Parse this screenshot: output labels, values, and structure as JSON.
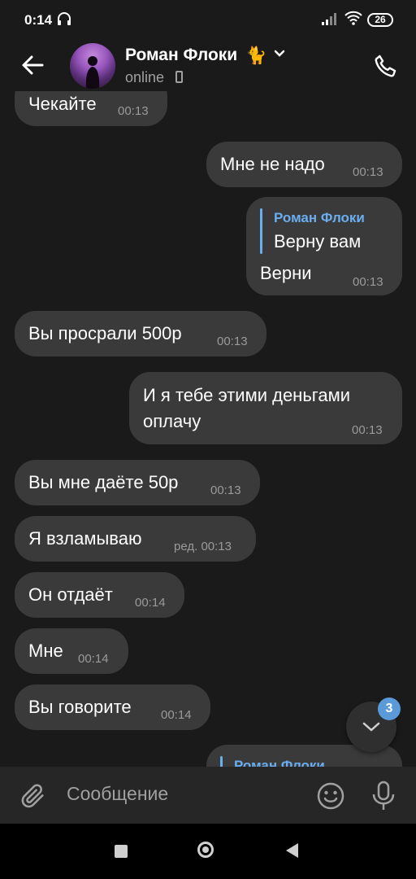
{
  "status_bar": {
    "time": "0:14",
    "battery": "26"
  },
  "header": {
    "contact_name": "Роман Флоки",
    "name_emoji": "🐈",
    "status": "online"
  },
  "messages": [
    {
      "side": "in",
      "text": "Чекайте",
      "time": "00:13"
    },
    {
      "side": "out",
      "text": "Мне не надо",
      "time": "00:13"
    },
    {
      "side": "out",
      "reply_name": "Роман Флоки",
      "reply_text": "Верну вам",
      "text": "Верни",
      "time": "00:13"
    },
    {
      "side": "in",
      "text": "Вы просрали 500р",
      "time": "00:13"
    },
    {
      "side": "out",
      "text_line1": "И я тебе этими деньгами",
      "text_line2": "оплачу",
      "time": "00:13"
    },
    {
      "side": "in",
      "text": "Вы мне даёте 50р",
      "time": "00:13"
    },
    {
      "side": "in",
      "text": "Я взламываю",
      "time": "ред. 00:13"
    },
    {
      "side": "in",
      "text": "Он отдаёт",
      "time": "00:14"
    },
    {
      "side": "in",
      "text": "Мне",
      "time": "00:14"
    },
    {
      "side": "in",
      "text": "Вы говорите",
      "time": "00:14"
    },
    {
      "side": "out",
      "reply_name": "Роман Флоки"
    }
  ],
  "scroll_down": {
    "unread_count": "3"
  },
  "composer": {
    "placeholder": "Сообщение"
  },
  "colors": {
    "background": "#1a1a1a",
    "bubble": "#3a3a3a",
    "accent": "#6aaef0",
    "badge": "#5b9ad8"
  },
  "icons": [
    "headphones-icon",
    "signal-icon",
    "wifi-icon",
    "back-arrow-icon",
    "chevron-down-icon",
    "call-icon",
    "chevron-down-icon",
    "paperclip-icon",
    "emoji-icon",
    "microphone-icon"
  ]
}
